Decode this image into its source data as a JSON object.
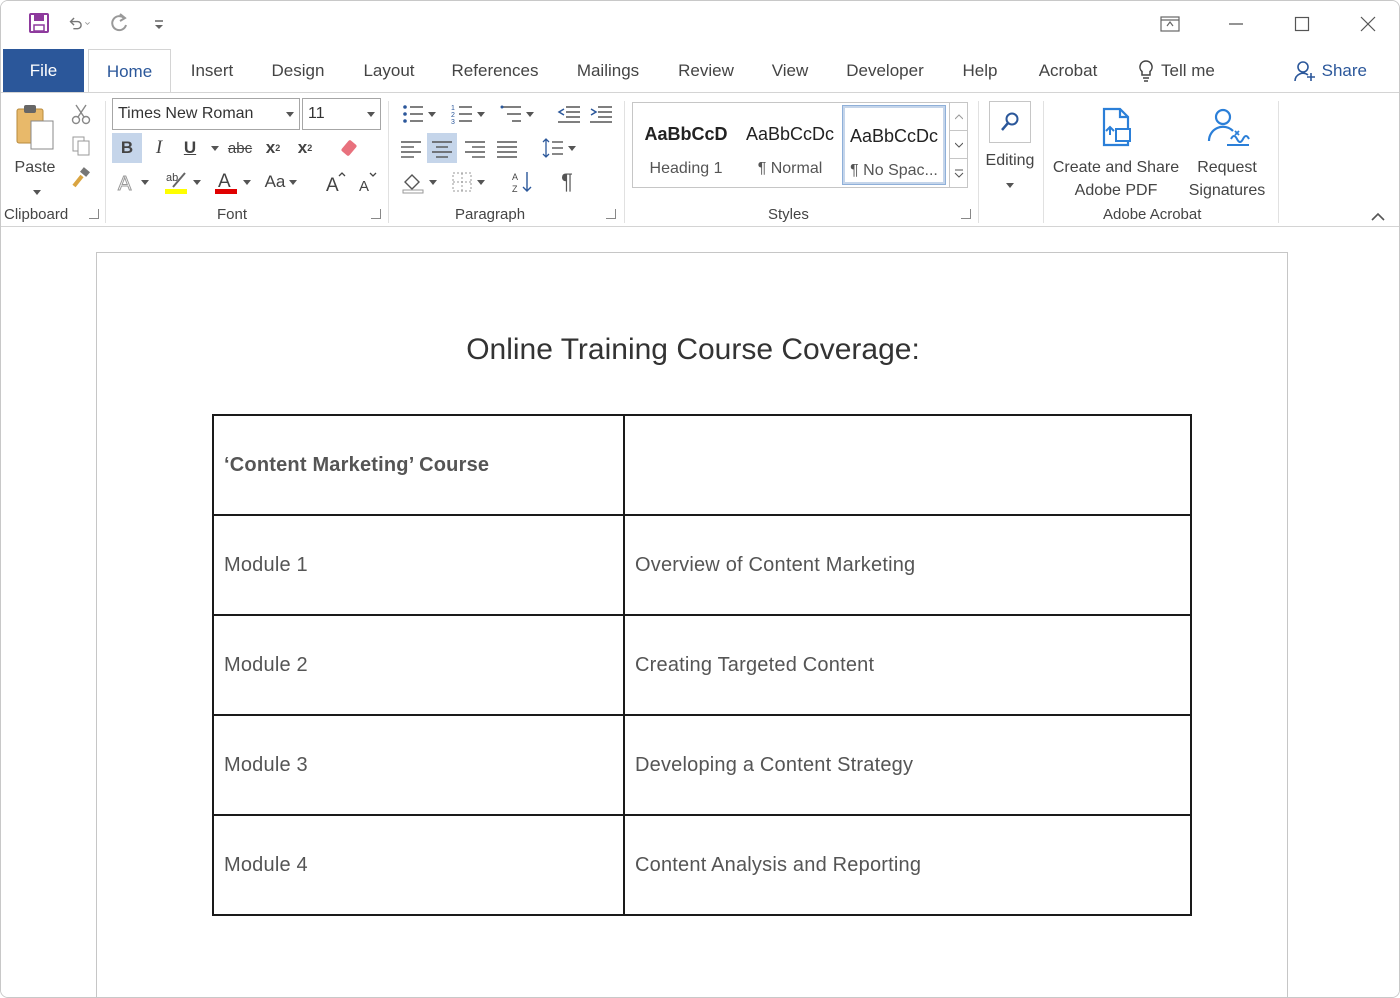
{
  "titlebar": {
    "qat": [
      "save-icon",
      "undo-icon",
      "redo-icon",
      "customize-icon"
    ],
    "controls": [
      "ribbon-display-icon",
      "minimize-icon",
      "maximize-icon",
      "close-icon"
    ]
  },
  "tabs": {
    "file": "File",
    "home": "Home",
    "others": [
      "Insert",
      "Design",
      "Layout",
      "References",
      "Mailings",
      "Review",
      "View",
      "Developer",
      "Help",
      "Acrobat"
    ],
    "tellme": "Tell me",
    "share": "Share"
  },
  "ribbon": {
    "clipboard": {
      "label": "Clipboard",
      "paste": "Paste"
    },
    "font": {
      "label": "Font",
      "name": "Times New Roman",
      "size": "11",
      "bold": "B",
      "italic": "I",
      "underline": "U",
      "strike": "abc",
      "sub": "x",
      "sup": "x",
      "case": "Aa"
    },
    "paragraph": {
      "label": "Paragraph",
      "pilcrow": "¶"
    },
    "styles": {
      "label": "Styles",
      "items": [
        {
          "preview": "AaBbCcD",
          "name": "Heading 1"
        },
        {
          "preview": "AaBbCcDc",
          "name": "¶ Normal"
        },
        {
          "preview": "AaBbCcDc",
          "name": "¶ No Spac..."
        }
      ]
    },
    "editing": {
      "label": "Editing"
    },
    "acrobat": {
      "label": "Adobe Acrobat",
      "create_line1": "Create and Share",
      "create_line2": "Adobe PDF",
      "request_line1": "Request",
      "request_line2": "Signatures"
    }
  },
  "colors": {
    "accent": "#2b579a",
    "highlight": "#ffff00",
    "font_color": "#e00000",
    "selected": "#c5d5ea"
  },
  "document": {
    "title": "Online Training Course Coverage:",
    "table": [
      [
        "‘Content Marketing’ Course",
        ""
      ],
      [
        "Module 1",
        "Overview of Content Marketing"
      ],
      [
        "Module 2",
        "Creating Targeted Content"
      ],
      [
        "Module 3",
        "Developing a Content Strategy"
      ],
      [
        "Module 4",
        "Content Analysis and Reporting"
      ]
    ]
  }
}
